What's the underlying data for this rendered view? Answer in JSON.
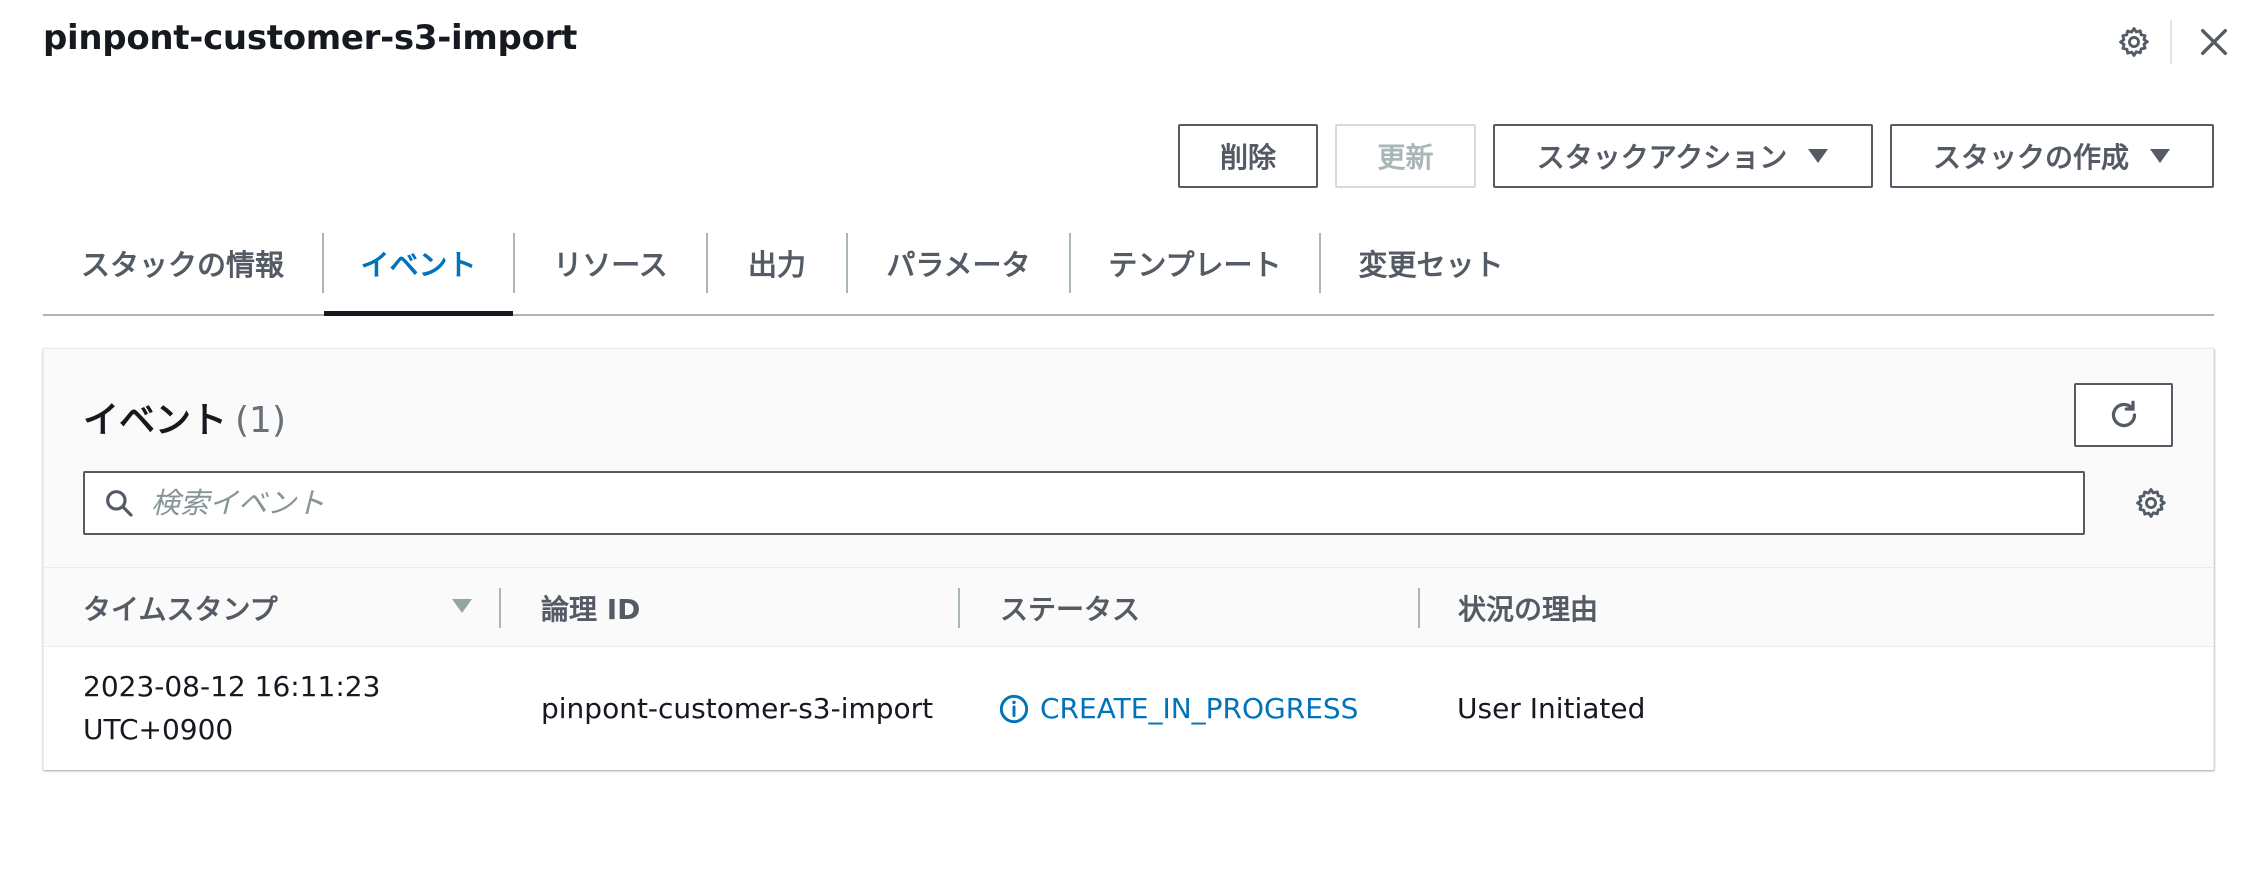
{
  "header": {
    "title": "pinpont-customer-s3-import",
    "icons": [
      "gear-icon",
      "close-icon"
    ]
  },
  "actions": {
    "delete_label": "削除",
    "update_label": "更新",
    "stack_actions_label": "スタックアクション",
    "create_stack_label": "スタックの作成"
  },
  "tabs": [
    {
      "label": "スタックの情報",
      "active": false
    },
    {
      "label": "イベント",
      "active": true
    },
    {
      "label": "リソース",
      "active": false
    },
    {
      "label": "出力",
      "active": false
    },
    {
      "label": "パラメータ",
      "active": false
    },
    {
      "label": "テンプレート",
      "active": false
    },
    {
      "label": "変更セット",
      "active": false
    }
  ],
  "events": {
    "title": "イベント",
    "count": "(1)",
    "search_placeholder": "検索イベント",
    "columns": [
      "タイムスタンプ",
      "論理 ID",
      "ステータス",
      "状況の理由"
    ],
    "rows": [
      {
        "timestamp_line1": "2023-08-12 16:11:23",
        "timestamp_line2": "UTC+0900",
        "logical_id": "pinpont-customer-s3-import",
        "status": "CREATE_IN_PROGRESS",
        "status_icon": "info-icon",
        "reason": "User Initiated"
      }
    ]
  },
  "colors": {
    "accent": "#0073bb",
    "text": "#16191f",
    "muted": "#545b64",
    "disabled": "#aab7b8"
  }
}
